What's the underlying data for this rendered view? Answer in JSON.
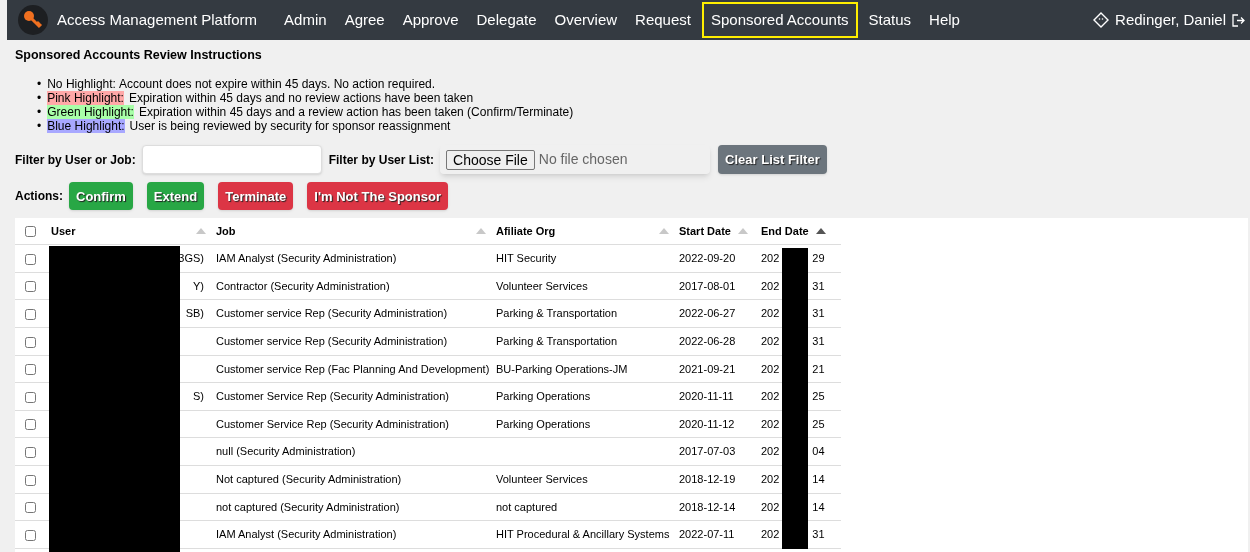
{
  "nav": {
    "brand": "Access Management Platform",
    "items": [
      {
        "label": "Admin",
        "selected": false
      },
      {
        "label": "Agree",
        "selected": false
      },
      {
        "label": "Approve",
        "selected": false
      },
      {
        "label": "Delegate",
        "selected": false
      },
      {
        "label": "Overview",
        "selected": false
      },
      {
        "label": "Request",
        "selected": false
      },
      {
        "label": "Sponsored Accounts",
        "selected": true
      },
      {
        "label": "Status",
        "selected": false
      },
      {
        "label": "Help",
        "selected": false
      }
    ],
    "user": "Redinger, Daniel"
  },
  "instructions": {
    "title": "Sponsored Accounts Review Instructions",
    "items": [
      {
        "bullet": "•",
        "label": "No Highlight:",
        "text": "Account does not expire within 45 days. No action required."
      },
      {
        "bullet": "•",
        "label": "Pink Highlight:",
        "text": "Expiration within 45 days and no review actions have been taken",
        "color": "#ffa8a8"
      },
      {
        "bullet": "•",
        "label": "Green Highlight:",
        "text": "Expiration within 45 days and a review action has been taken (Confirm/Terminate)",
        "color": "#a8ffa8"
      },
      {
        "bullet": "•",
        "label": "Blue Highlight:",
        "text": "User is being reviewed by security for sponsor reassignment",
        "color": "#a8a8ff"
      }
    ]
  },
  "filters": {
    "user_or_job_label": "Filter by User or Job:",
    "user_list_label": "Filter by User List:",
    "choose_file": "Choose File",
    "no_file": "No file chosen",
    "clear": "Clear List Filter"
  },
  "actions": {
    "label": "Actions:",
    "buttons": [
      {
        "label": "Confirm",
        "kind": "positive"
      },
      {
        "label": "Extend",
        "kind": "positive"
      },
      {
        "label": "Terminate",
        "kind": "danger"
      },
      {
        "label": "I'm Not The Sponsor",
        "kind": "danger"
      }
    ]
  },
  "table": {
    "select_all_checked": false,
    "columns": [
      {
        "label": "User",
        "sorted": false
      },
      {
        "label": "Job",
        "sorted": false
      },
      {
        "label": "Afiliate Org",
        "sorted": false
      },
      {
        "label": "Start Date",
        "sorted": false
      },
      {
        "label": "End Date",
        "sorted": true
      }
    ],
    "rows": [
      {
        "checked": false,
        "user": "3GS)",
        "job": "IAM Analyst (Security Administration)",
        "org": "HIT Security",
        "start": "2022-09-20",
        "end_start": "202",
        "end_end": "29"
      },
      {
        "checked": false,
        "user": "Y)",
        "job": "Contractor (Security Administration)",
        "org": "Volunteer Services",
        "start": "2017-08-01",
        "end_start": "202",
        "end_end": "31"
      },
      {
        "checked": false,
        "user": "SB)",
        "job": "Customer service Rep (Security Administration)",
        "org": "Parking & Transportation",
        "start": "2022-06-27",
        "end_start": "202",
        "end_end": "31"
      },
      {
        "checked": false,
        "job": "Customer service Rep (Security Administration)",
        "org": "Parking & Transportation",
        "start": "2022-06-28",
        "end_start": "202",
        "end_end": "31"
      },
      {
        "checked": false,
        "job": "Customer service Rep (Fac Planning And Development)",
        "org": "BU-Parking Operations-JM",
        "start": "2021-09-21",
        "end_start": "202",
        "end_end": "21"
      },
      {
        "checked": false,
        "user": "S)",
        "job": "Customer Service Rep (Security Administration)",
        "org": "Parking Operations",
        "start": "2020-11-11",
        "end_start": "202",
        "end_end": "25"
      },
      {
        "checked": false,
        "job": "Customer Service Rep (Security Administration)",
        "org": "Parking Operations",
        "start": "2020-11-12",
        "end_start": "202",
        "end_end": "25"
      },
      {
        "checked": false,
        "job": "null (Security Administration)",
        "start": "2017-07-03",
        "end_start": "202",
        "end_end": "04"
      },
      {
        "checked": false,
        "job": "Not captured (Security Administration)",
        "org": "Volunteer Services",
        "start": "2018-12-19",
        "end_start": "202",
        "end_end": "14"
      },
      {
        "checked": false,
        "job": "not captured (Security Administration)",
        "org": "not captured",
        "start": "2018-12-14",
        "end_start": "202",
        "end_end": "14"
      },
      {
        "checked": false,
        "job": "IAM Analyst (Security Administration)",
        "org": "HIT Procedural & Ancillary Systems",
        "start": "2022-07-11",
        "end_start": "202",
        "end_end": "31"
      }
    ]
  }
}
